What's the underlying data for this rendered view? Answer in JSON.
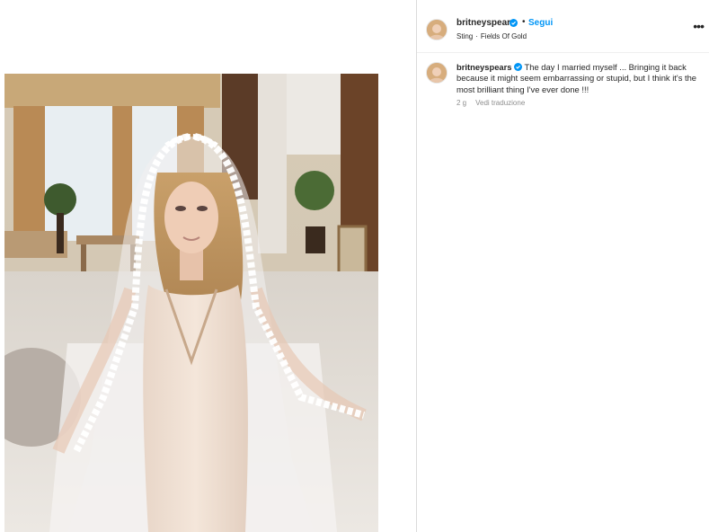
{
  "post": {
    "username": "britneyspears",
    "verified": true,
    "follow_label": "Segui",
    "separator": "•",
    "audio": {
      "artist": "Sting",
      "song": "Fields Of Gold",
      "separator": "·"
    },
    "more_icon": "more-horizontal-icon",
    "more_label": "•••"
  },
  "caption": {
    "username": "britneyspears",
    "text": "The day I married myself ... Bringing it back because it might seem embarrassing or stupid, but I think it's the most brilliant thing I've ever done !!!",
    "age": "2 g",
    "translate_label": "Vedi traduzione"
  },
  "colors": {
    "follow": "#0095f6",
    "verified": "#0095f6",
    "muted": "#8e8e8e"
  }
}
